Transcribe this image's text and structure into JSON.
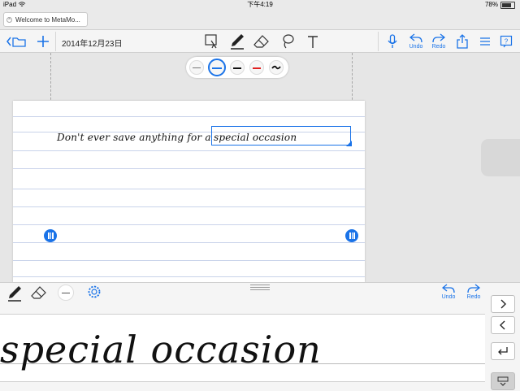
{
  "status_bar": {
    "device": "iPad",
    "time": "下午4:19",
    "battery": "78%"
  },
  "browser_tab": {
    "title": "Welcome to MetaMo..."
  },
  "toolbar": {
    "date": "2014年12月23日",
    "undo_label": "Undo",
    "redo_label": "Redo"
  },
  "pen_styles": [
    {
      "name": "thin-gray",
      "color": "#777777"
    },
    {
      "name": "blue-selected",
      "color": "#1a73e8"
    },
    {
      "name": "black",
      "color": "#111111"
    },
    {
      "name": "red",
      "color": "#e02020"
    }
  ],
  "note": {
    "handwriting_before": "Don't ever save anything for a",
    "handwriting_selected": "special occasion"
  },
  "input_panel": {
    "undo_label": "Undo",
    "redo_label": "Redo",
    "recognized_text": "special occasion"
  },
  "colors": {
    "accent": "#1a73e8",
    "red": "#e02020"
  }
}
